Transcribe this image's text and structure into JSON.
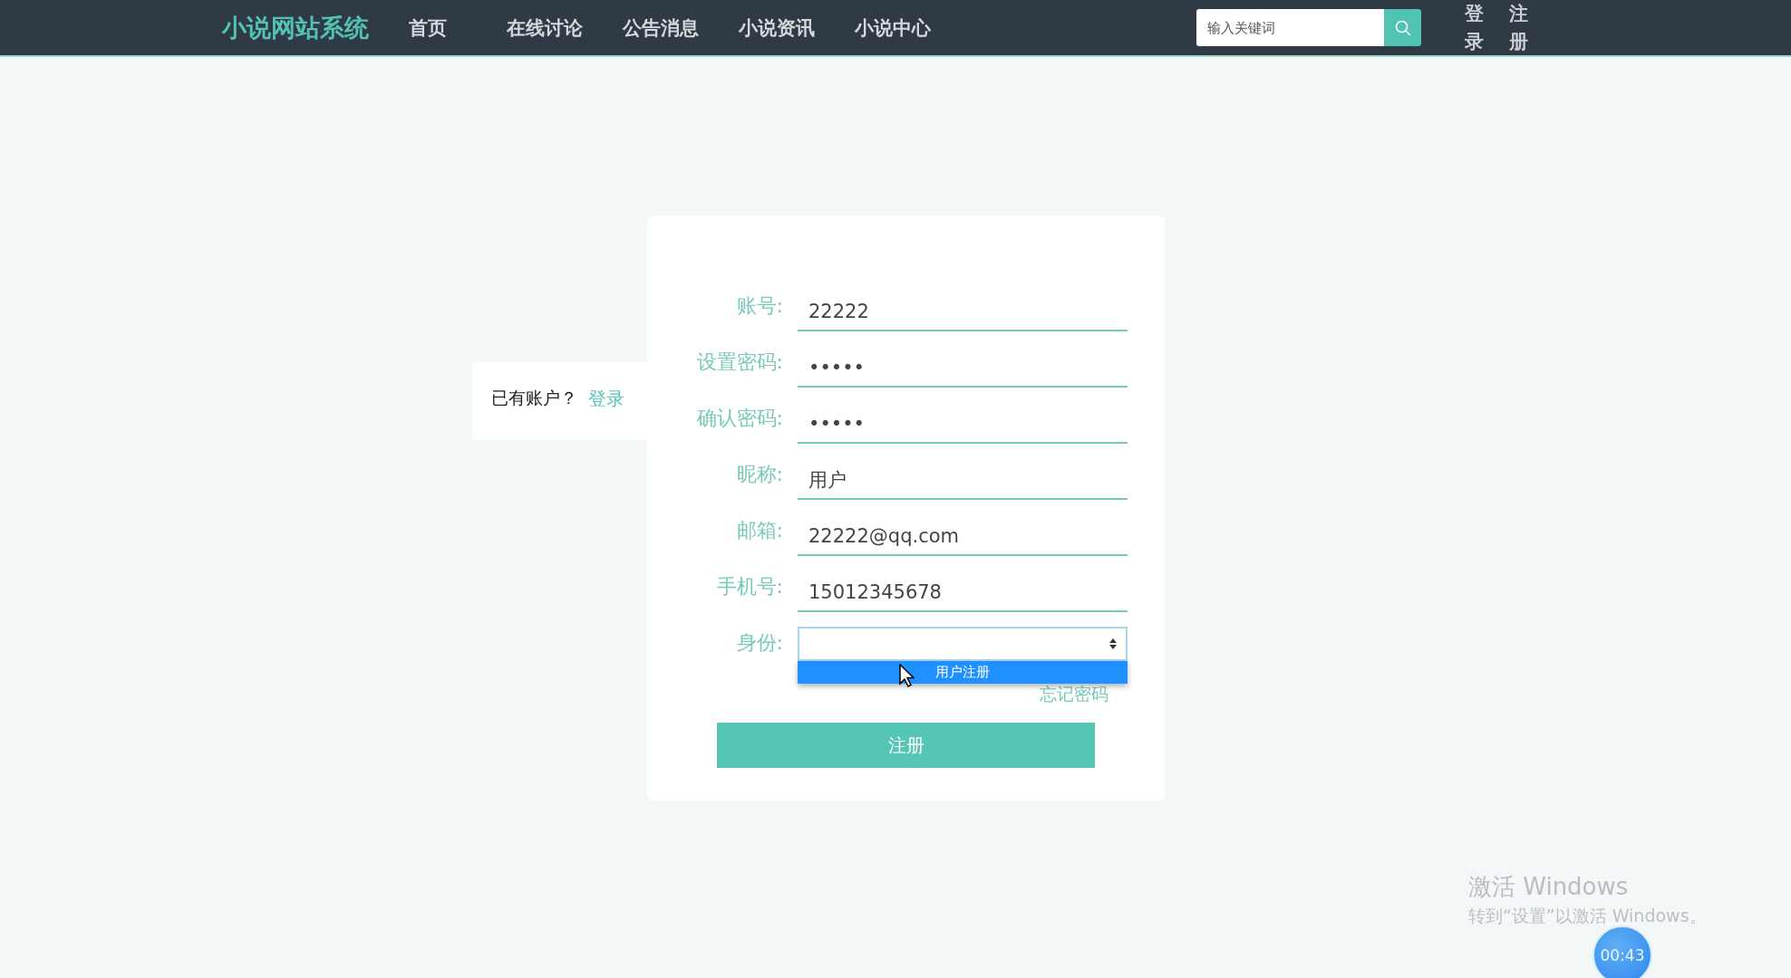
{
  "header": {
    "logo": "小说网站系统",
    "nav": [
      {
        "label": "首页"
      },
      {
        "label": "在线讨论"
      },
      {
        "label": "公告消息"
      },
      {
        "label": "小说资讯"
      },
      {
        "label": "小说中心"
      }
    ],
    "search": {
      "placeholder": "输入关键词"
    },
    "auth_links": [
      "登录",
      "注册"
    ]
  },
  "side_panel": {
    "text": "已有账户？",
    "link": "登录"
  },
  "form": {
    "fields": [
      {
        "label": "账号:",
        "kind": "text",
        "value": "22222"
      },
      {
        "label": "设置密码:",
        "kind": "text",
        "value": "•••••"
      },
      {
        "label": "确认密码:",
        "kind": "text",
        "value": "•••••"
      },
      {
        "label": "昵称:",
        "kind": "text",
        "value": "用户"
      },
      {
        "label": "邮箱:",
        "kind": "text",
        "value": "22222@qq.com"
      },
      {
        "label": "手机号:",
        "kind": "text",
        "value": "15012345678"
      },
      {
        "label": "身份:",
        "kind": "select",
        "expanded": true,
        "options": [
          {
            "label": "用户注册",
            "selected": true
          }
        ]
      }
    ],
    "forgot_link": "忘记密码",
    "submit": "注册"
  },
  "os_overlay": {
    "title": "激活 Windows",
    "text": "转到“设置”以激活 Windows。"
  },
  "recorder": {
    "time": "00:43"
  }
}
